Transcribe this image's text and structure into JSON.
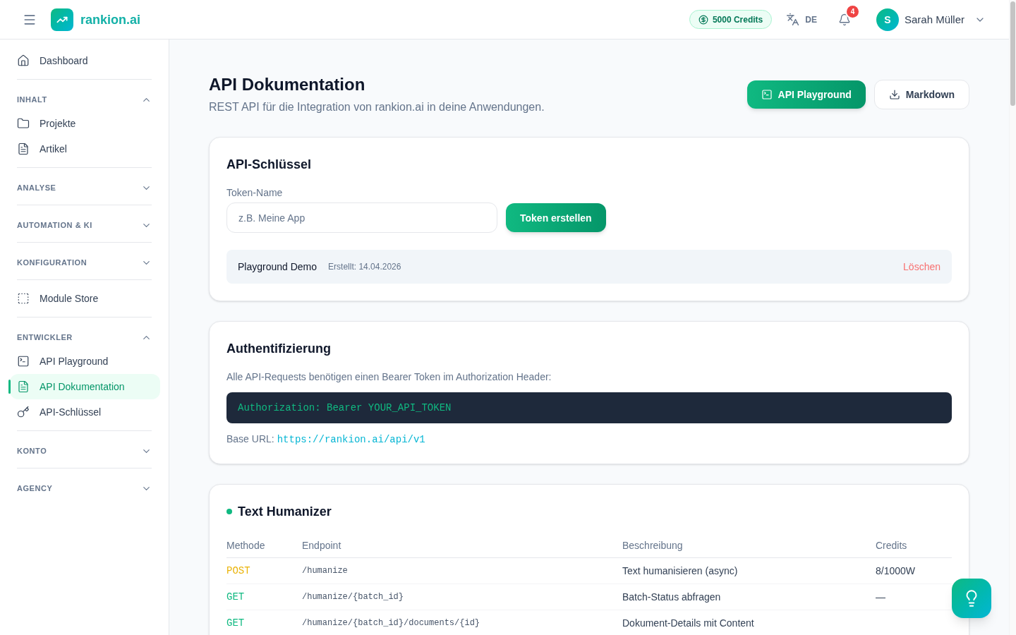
{
  "header": {
    "logo_text": "rankion.ai",
    "credits": "5000 Credits",
    "language": "DE",
    "notifications": "4",
    "user": {
      "initial": "S",
      "name": "Sarah Müller"
    }
  },
  "sidebar": [
    {
      "kind": "link",
      "label": "Dashboard",
      "selected": false
    },
    {
      "kind": "section",
      "title": "INHALT",
      "expanded": true,
      "items": [
        {
          "label": "Projekte",
          "selected": false
        },
        {
          "label": "Artikel",
          "selected": false
        }
      ]
    },
    {
      "kind": "section",
      "title": "ANALYSE",
      "expanded": false
    },
    {
      "kind": "section",
      "title": "AUTOMATION & KI",
      "expanded": false
    },
    {
      "kind": "section",
      "title": "KONFIGURATION",
      "expanded": false
    },
    {
      "kind": "link",
      "label": "Module Store",
      "selected": false
    },
    {
      "kind": "section",
      "title": "ENTWICKLER",
      "expanded": true,
      "items": [
        {
          "label": "API Playground",
          "selected": false
        },
        {
          "label": "API Dokumentation",
          "selected": true
        },
        {
          "label": "API-Schlüssel",
          "selected": false
        }
      ]
    },
    {
      "kind": "section",
      "title": "KONTO",
      "expanded": false
    },
    {
      "kind": "section",
      "title": "AGENCY",
      "expanded": false
    }
  ],
  "page": {
    "title": "API Dokumentation",
    "subtitle": "REST API für die Integration von rankion.ai in deine Anwendungen.",
    "buttons": [
      {
        "kind": "primary",
        "label": "API Playground"
      },
      {
        "kind": "secondary",
        "label": "Markdown"
      }
    ]
  },
  "api_keys": {
    "title": "API-Schlüssel",
    "token_field": {
      "label": "Token-Name",
      "placeholder": "z.B. Meine App"
    },
    "create_button": "Token erstellen",
    "tokens": [
      {
        "name": "Playground Demo",
        "created": "Erstellt: 14.04.2026",
        "delete": "Löschen"
      }
    ]
  },
  "auth": {
    "title": "Authentifizierung",
    "description": "Alle API-Requests benötigen einen Bearer Token im Authorization Header:",
    "code": "Authorization: Bearer YOUR_API_TOKEN",
    "base_url_label": "Base URL:",
    "base_url": "https://rankion.ai/api/v1"
  },
  "endpoint_groups": [
    {
      "title": "Text Humanizer",
      "columns": [
        "Methode",
        "Endpoint",
        "Beschreibung",
        "Credits"
      ],
      "rows": [
        {
          "method": "POST",
          "color": "#eab308",
          "endpoint": "/humanize",
          "description": "Text humanisieren (async)",
          "credits": "8/1000W"
        },
        {
          "method": "GET",
          "color": "#10b981",
          "endpoint": "/humanize/{batch_id}",
          "description": "Batch-Status abfragen",
          "credits": "—"
        },
        {
          "method": "GET",
          "color": "#10b981",
          "endpoint": "/humanize/{batch_id}/documents/{id}",
          "description": "Dokument-Details mit Content"
        }
      ]
    }
  ]
}
